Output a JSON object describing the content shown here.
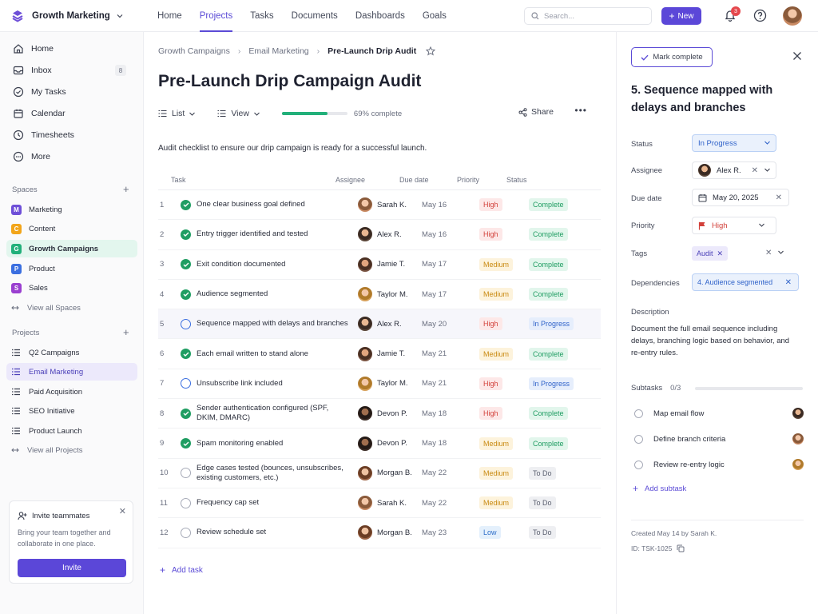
{
  "app": {
    "workspace": "Growth Marketing"
  },
  "topnav": {
    "items": [
      {
        "label": "Home"
      },
      {
        "label": "Projects"
      },
      {
        "label": "Tasks"
      },
      {
        "label": "Documents"
      },
      {
        "label": "Dashboards"
      },
      {
        "label": "Goals"
      }
    ],
    "active": "Projects"
  },
  "search": {
    "placeholder": "Search..."
  },
  "new_button": {
    "label": "New"
  },
  "notifications": {
    "count": "3"
  },
  "sidebar": {
    "main": [
      {
        "label": "Home",
        "icon": "home-icon"
      },
      {
        "label": "Inbox",
        "icon": "inbox-icon",
        "count": "8"
      },
      {
        "label": "My Tasks",
        "icon": "check-circle-icon"
      },
      {
        "label": "Calendar",
        "icon": "calendar-icon"
      },
      {
        "label": "Timesheets",
        "icon": "clock-icon"
      },
      {
        "label": "More",
        "icon": "more-icon"
      }
    ],
    "spaces_title": "Spaces",
    "spaces": [
      {
        "letter": "M",
        "label": "Marketing",
        "color": "#6e4fd8"
      },
      {
        "letter": "C",
        "label": "Content",
        "color": "#f2a51a"
      },
      {
        "letter": "G",
        "label": "Growth Campaigns",
        "color": "#22b07a"
      },
      {
        "letter": "P",
        "label": "Product",
        "color": "#3b6fe0"
      },
      {
        "letter": "S",
        "label": "Sales",
        "color": "#9a3fd0"
      }
    ],
    "view_all_spaces": "View all Spaces",
    "projects_title": "Projects",
    "projects": [
      {
        "label": "Q2 Campaigns"
      },
      {
        "label": "Email Marketing"
      },
      {
        "label": "Paid Acquisition"
      },
      {
        "label": "SEO Initiative"
      },
      {
        "label": "Product Launch"
      }
    ],
    "view_all_projects": "View all Projects",
    "invite": {
      "title": "Invite teammates",
      "text": "Bring your team together and collaborate in one place.",
      "button": "Invite"
    }
  },
  "breadcrumb": [
    "Growth Campaigns",
    "Email Marketing",
    "Pre-Launch Drip Audit"
  ],
  "page_title": "Pre-Launch Drip Campaign Audit",
  "toolbar": {
    "list_label": "List",
    "view_label": "View",
    "progress": 0.69,
    "progress_label": "69% complete",
    "share_label": "Share"
  },
  "description": "Audit checklist to ensure our drip campaign is ready for a successful launch.",
  "table": {
    "headers": [
      "Task",
      "Assignee",
      "Due date",
      "Priority",
      "Status"
    ],
    "rows": [
      {
        "num": "1",
        "task": "One clear business goal defined",
        "assignee": "Sarah K.",
        "due": "May 16",
        "priority": "High",
        "status": "Complete",
        "check": "done"
      },
      {
        "num": "2",
        "task": "Entry trigger identified and tested",
        "assignee": "Alex R.",
        "due": "May 16",
        "priority": "High",
        "status": "Complete",
        "check": "done"
      },
      {
        "num": "3",
        "task": "Exit condition documented",
        "assignee": "Jamie T.",
        "due": "May 17",
        "priority": "Medium",
        "status": "Complete",
        "check": "done"
      },
      {
        "num": "4",
        "task": "Audience segmented",
        "assignee": "Taylor M.",
        "due": "May 17",
        "priority": "Medium",
        "status": "Complete",
        "check": "done"
      },
      {
        "num": "5",
        "task": "Sequence mapped with delays and branches",
        "assignee": "Alex R.",
        "due": "May 20",
        "priority": "High",
        "status": "In Progress",
        "check": "prog"
      },
      {
        "num": "6",
        "task": "Each email written to stand alone",
        "assignee": "Jamie T.",
        "due": "May 21",
        "priority": "Medium",
        "status": "Complete",
        "check": "done"
      },
      {
        "num": "7",
        "task": "Unsubscribe link included",
        "assignee": "Taylor M.",
        "due": "May 21",
        "priority": "High",
        "status": "In Progress",
        "check": "prog"
      },
      {
        "num": "8",
        "task": "Sender authentication configured (SPF, DKIM, DMARC)",
        "assignee": "Devon P.",
        "due": "May 18",
        "priority": "High",
        "status": "Complete",
        "check": "done"
      },
      {
        "num": "9",
        "task": "Spam monitoring enabled",
        "assignee": "Devon P.",
        "due": "May 18",
        "priority": "Medium",
        "status": "Complete",
        "check": "done"
      },
      {
        "num": "10",
        "task": "Edge cases tested (bounces, unsubscribes, existing customers, etc.)",
        "assignee": "Morgan B.",
        "due": "May 22",
        "priority": "Medium",
        "status": "To Do",
        "check": "todo"
      },
      {
        "num": "11",
        "task": "Frequency cap set",
        "assignee": "Sarah K.",
        "due": "May 22",
        "priority": "Medium",
        "status": "To Do",
        "check": "todo"
      },
      {
        "num": "12",
        "task": "Review schedule set",
        "assignee": "Morgan B.",
        "due": "May 23",
        "priority": "Low",
        "status": "To Do",
        "check": "todo"
      }
    ],
    "add_label": "Add task"
  },
  "colors": {
    "accent": "#5b47d8",
    "high_bg": "#fde8e8",
    "high_fg": "#d2403a",
    "medium_bg": "#fdf3dc",
    "medium_fg": "#c98a12",
    "low_bg": "#e4f0fc",
    "low_fg": "#2f6fc9",
    "complete_bg": "#e2f6ec",
    "complete_fg": "#1f9d62",
    "progress_bg": "#e6eefc",
    "progress_fg": "#2f62c9",
    "todo_bg": "#eeeff2",
    "todo_fg": "#5b6070"
  },
  "panel": {
    "mark_complete": "Mark complete",
    "title": "5. Sequence mapped with delays and branches",
    "labels": {
      "status": "Status",
      "assignee": "Assignee",
      "due": "Due date",
      "priority": "Priority",
      "tags": "Tags",
      "dependencies": "Dependencies",
      "description": "Description",
      "subtasks": "Subtasks"
    },
    "status": "In Progress",
    "assignee": "Alex R.",
    "due": "May 20, 2025",
    "priority": "High",
    "tag": "Audit",
    "dependency": "4. Audience segmented",
    "description": "Document the full email sequence including delays, branching logic based on behavior, and re-entry rules.",
    "subtasks_count": "0/3",
    "subtasks": [
      {
        "label": "Map email flow"
      },
      {
        "label": "Define branch criteria"
      },
      {
        "label": "Review re-entry logic"
      }
    ],
    "add_subtask": "Add subtask",
    "created": "Created May 14 by Sarah K.",
    "id": "ID: TSK-1025"
  }
}
